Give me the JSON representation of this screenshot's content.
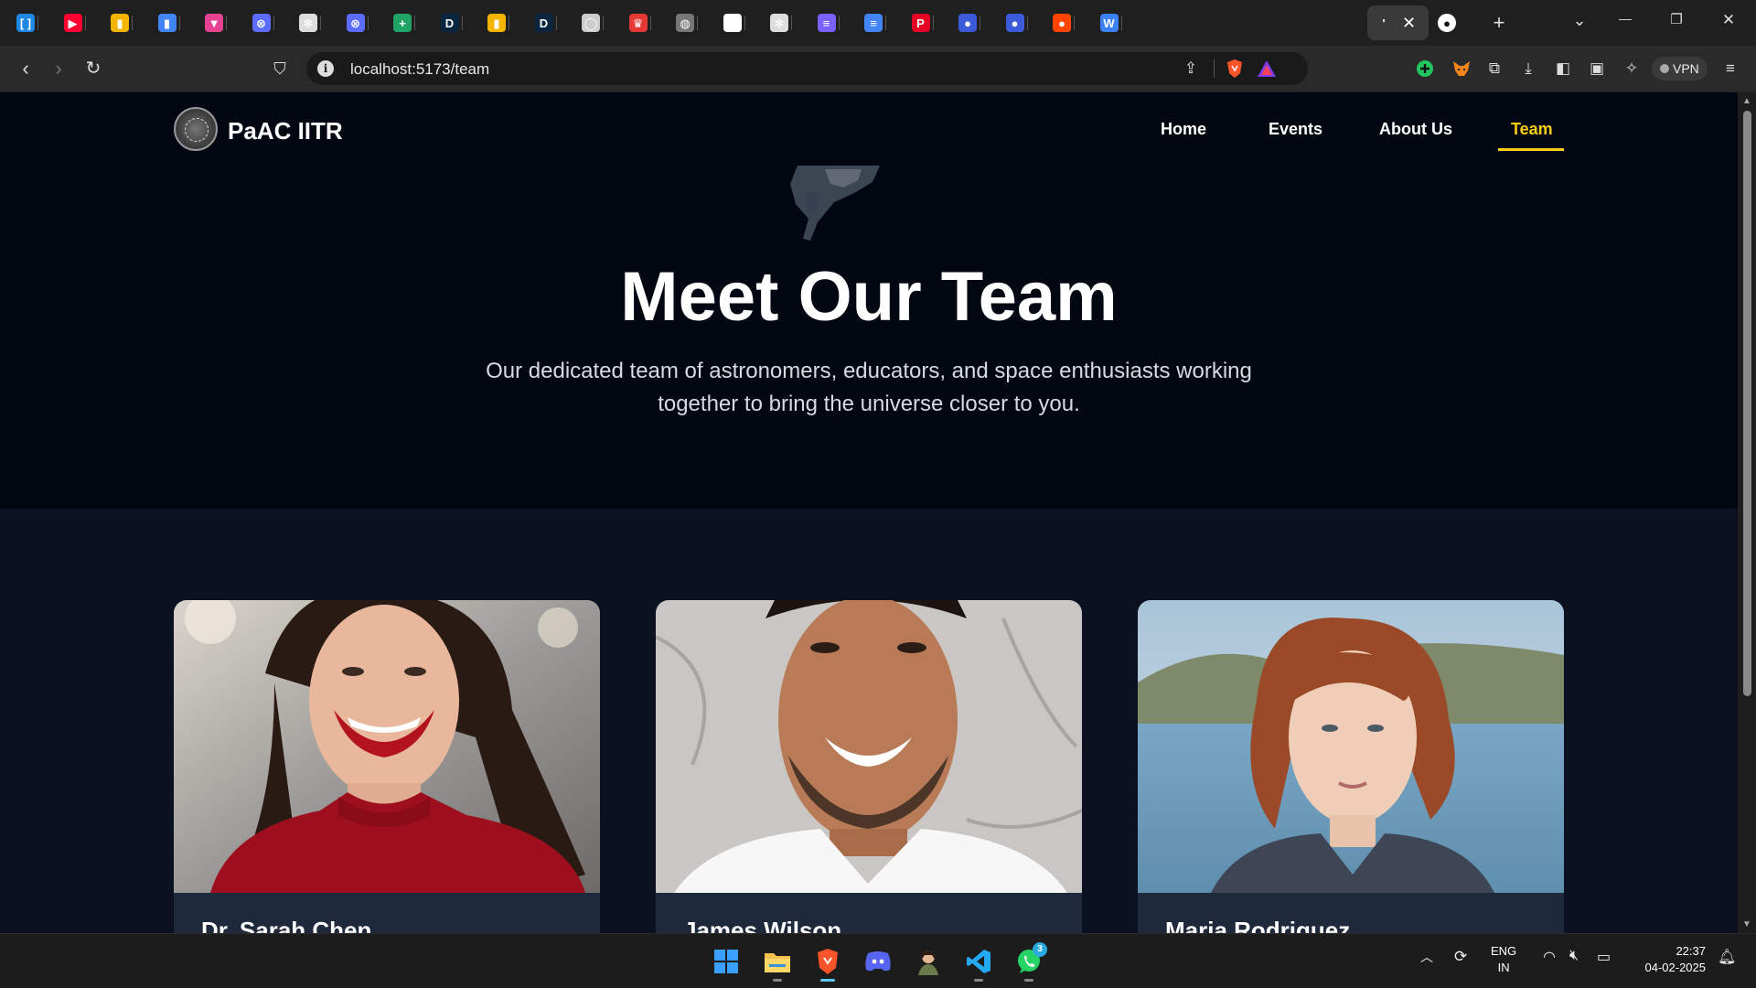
{
  "browser": {
    "tabs": [
      {
        "icon": "brackets-app-icon",
        "color": "#1e88e5",
        "glyph": "[ ]"
      },
      {
        "icon": "youtube-icon",
        "color": "#ff0033",
        "glyph": "▶"
      },
      {
        "icon": "bar-chart-icon",
        "color": "#f4b400",
        "glyph": "▮"
      },
      {
        "icon": "bar-chart-icon",
        "color": "#4285f4",
        "glyph": "▮"
      },
      {
        "icon": "triangle-app-icon",
        "color": "#e84393",
        "glyph": "▼"
      },
      {
        "icon": "compass-app-icon",
        "color": "#5b6cff",
        "glyph": "⊗"
      },
      {
        "icon": "openai-icon",
        "color": "#dddddd",
        "glyph": "✻"
      },
      {
        "icon": "compass-app-icon",
        "color": "#5b6cff",
        "glyph": "⊗"
      },
      {
        "icon": "plus-sheet-icon",
        "color": "#21a366",
        "glyph": "+"
      },
      {
        "icon": "d-letter-icon",
        "color": "#0a2540",
        "glyph": "D"
      },
      {
        "icon": "bar-chart-icon",
        "color": "#f4b400",
        "glyph": "▮"
      },
      {
        "icon": "d-letter-icon",
        "color": "#0a2540",
        "glyph": "D"
      },
      {
        "icon": "circle-app-icon",
        "color": "#cccccc",
        "glyph": "◯"
      },
      {
        "icon": "crown-app-icon",
        "color": "#e53935",
        "glyph": "♛"
      },
      {
        "icon": "globe-app-icon",
        "color": "#777777",
        "glyph": "◍"
      },
      {
        "icon": "github-icon",
        "color": "#ffffff",
        "glyph": "●"
      },
      {
        "icon": "openai-icon",
        "color": "#dddddd",
        "glyph": "✻"
      },
      {
        "icon": "list-app-icon",
        "color": "#7b61ff",
        "glyph": "≡"
      },
      {
        "icon": "docs-icon",
        "color": "#4285f4",
        "glyph": "≡"
      },
      {
        "icon": "pinterest-icon",
        "color": "#e60023",
        "glyph": "P"
      },
      {
        "icon": "speech-bubble-icon",
        "color": "#3b5bdb",
        "glyph": "●"
      },
      {
        "icon": "speech-bubble-icon",
        "color": "#3b5bdb",
        "glyph": "●"
      },
      {
        "icon": "reddit-icon",
        "color": "#ff4500",
        "glyph": "●"
      },
      {
        "icon": "w-letter-icon",
        "color": "#3b82f6",
        "glyph": "W"
      }
    ],
    "active_tab_icon": "blank-tab-icon",
    "after_tab_icon": "github-icon",
    "url": "localhost:5173/team",
    "vpn_label": "VPN"
  },
  "site": {
    "brand": "PaAC IITR",
    "nav": [
      {
        "label": "Home",
        "active": false
      },
      {
        "label": "Events",
        "active": false
      },
      {
        "label": "About Us",
        "active": false
      },
      {
        "label": "Team",
        "active": true
      }
    ],
    "hero": {
      "title": "Meet Our Team",
      "subtitle": "Our dedicated team of astronomers, educators, and space enthusiasts working together to bring the universe closer to you."
    },
    "members": [
      {
        "name": "Dr. Sarah Chen",
        "photo": "smiling-woman-red-sweater-photo"
      },
      {
        "name": "James Wilson",
        "photo": "smiling-man-white-tshirt-photo"
      },
      {
        "name": "Maria Rodriguez",
        "photo": "red-haired-woman-lake-photo"
      }
    ]
  },
  "taskbar": {
    "apps": [
      "windows-start-icon",
      "file-explorer-icon",
      "brave-browser-icon",
      "discord-icon",
      "app-portrait-icon",
      "vscode-icon",
      "whatsapp-icon"
    ],
    "whatsapp_badge": "3",
    "language": "ENG",
    "region": "IN",
    "time": "22:37",
    "date": "04-02-2025"
  }
}
